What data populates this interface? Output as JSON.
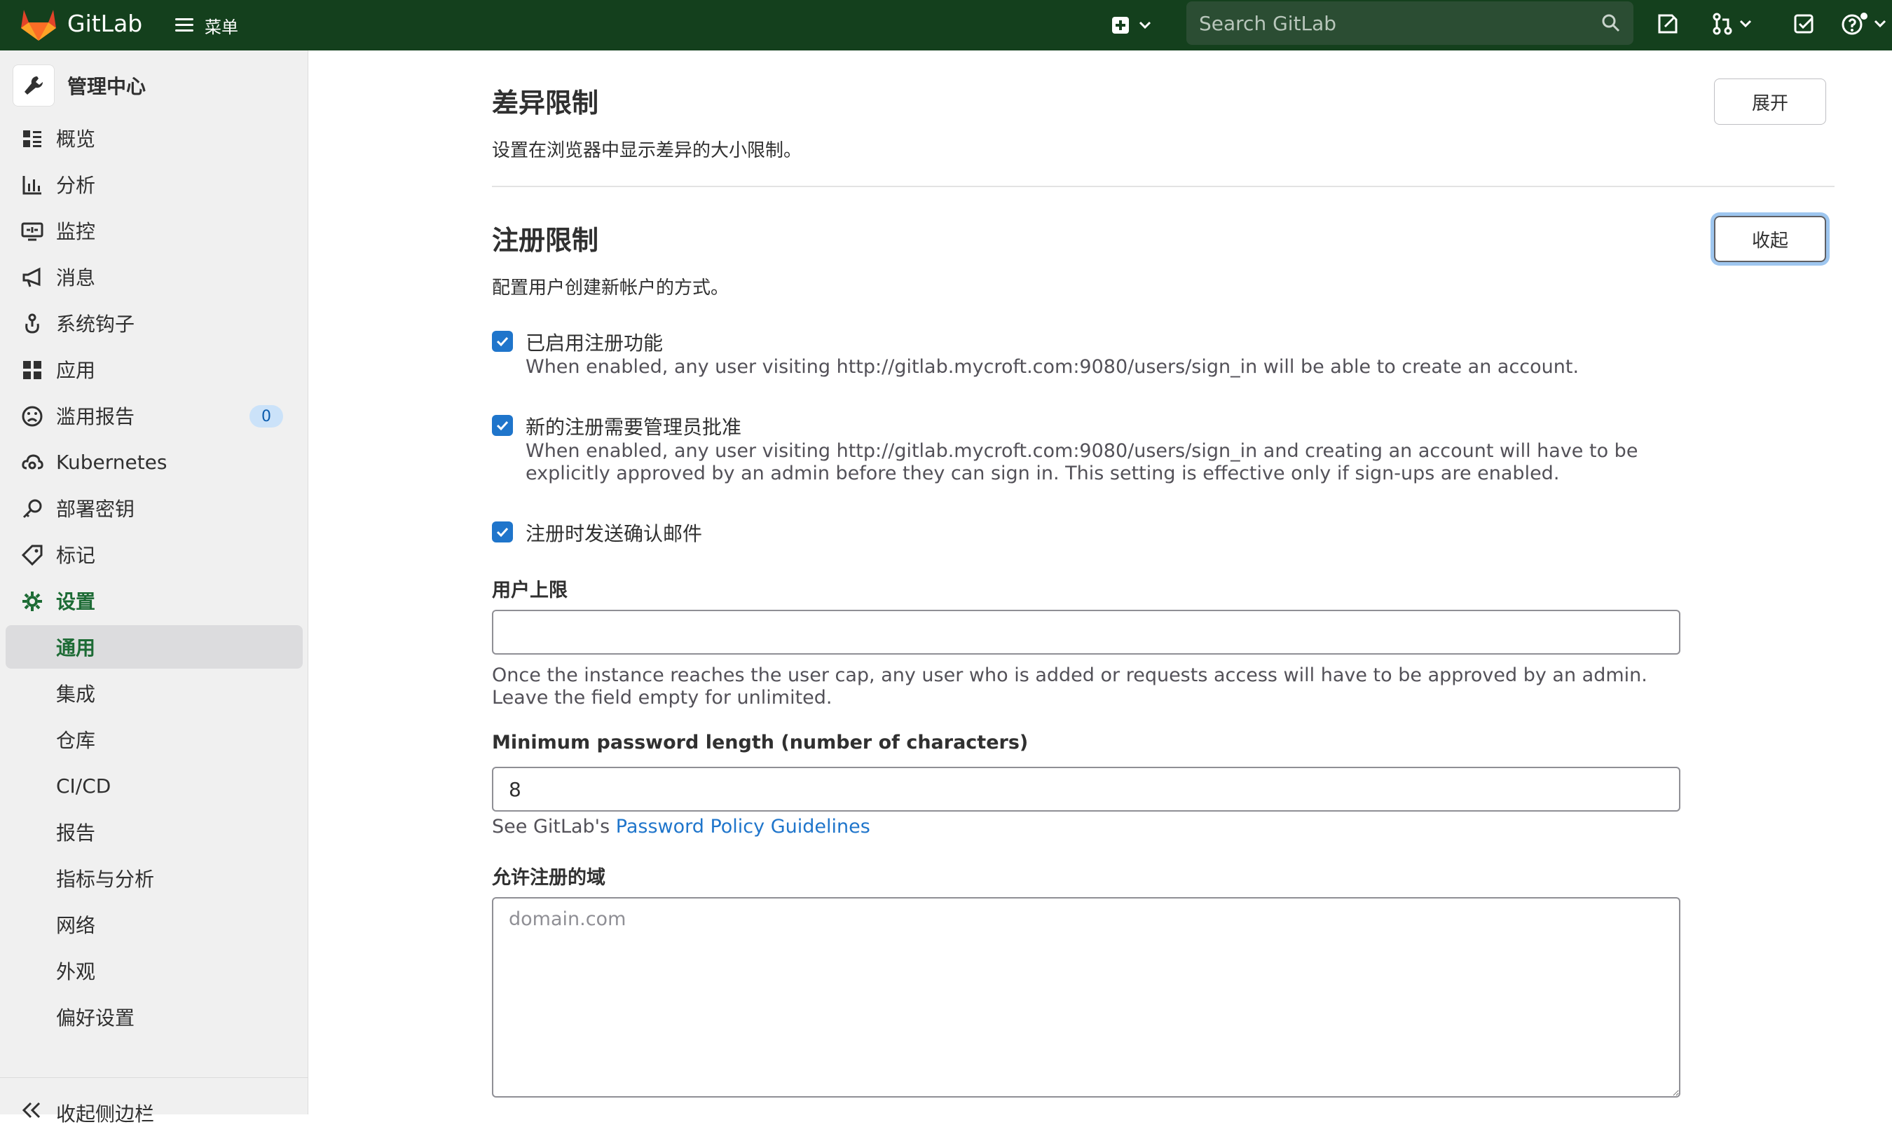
{
  "topbar": {
    "brand": "GitLab",
    "menu_label": "菜单",
    "search_placeholder": "Search GitLab"
  },
  "sidebar": {
    "header": "管理中心",
    "items": [
      {
        "label": "概览",
        "icon": "overview-icon"
      },
      {
        "label": "分析",
        "icon": "chart-icon"
      },
      {
        "label": "监控",
        "icon": "monitor-icon"
      },
      {
        "label": "消息",
        "icon": "megaphone-icon"
      },
      {
        "label": "系统钩子",
        "icon": "hook-icon"
      },
      {
        "label": "应用",
        "icon": "apps-icon"
      },
      {
        "label": "滥用报告",
        "icon": "frown-icon",
        "badge": "0"
      },
      {
        "label": "Kubernetes",
        "icon": "cloud-gear-icon"
      },
      {
        "label": "部署密钥",
        "icon": "key-icon"
      },
      {
        "label": "标记",
        "icon": "tag-icon"
      },
      {
        "label": "设置",
        "icon": "gear-icon"
      }
    ],
    "settings_sub": [
      "通用",
      "集成",
      "仓库",
      "CI/CD",
      "报告",
      "指标与分析",
      "网络",
      "外观",
      "偏好设置"
    ],
    "collapse_label": "收起侧边栏"
  },
  "diff_section": {
    "title": "差异限制",
    "description": "设置在浏览器中显示差异的大小限制。",
    "button": "展开"
  },
  "signup_section": {
    "title": "注册限制",
    "description": "配置用户创建新帐户的方式。",
    "button": "收起",
    "checkboxes": [
      {
        "label": "已启用注册功能",
        "checked": true,
        "help": "When enabled, any user visiting http://gitlab.mycroft.com:9080/users/sign_in will be able to create an account."
      },
      {
        "label": "新的注册需要管理员批准",
        "checked": true,
        "help": "When enabled, any user visiting http://gitlab.mycroft.com:9080/users/sign_in and creating an account will have to be explicitly approved by an admin before they can sign in. This setting is effective only if sign-ups are enabled."
      },
      {
        "label": "注册时发送确认邮件",
        "checked": true,
        "help": ""
      }
    ],
    "user_cap": {
      "label": "用户上限",
      "value": "",
      "help": "Once the instance reaches the user cap, any user who is added or requests access will have to be approved by an admin. Leave the field empty for unlimited."
    },
    "min_password": {
      "label": "Minimum password length (number of characters)",
      "value": "8",
      "help_prefix": "See GitLab's ",
      "help_link": "Password Policy Guidelines"
    },
    "allowed_domains": {
      "label": "允许注册的域",
      "placeholder": "domain.com"
    }
  },
  "colors": {
    "topbar": "#14401d",
    "accent_green": "#1d6b35",
    "checkbox_blue": "#1f75cb",
    "link_blue": "#1f75cb"
  }
}
